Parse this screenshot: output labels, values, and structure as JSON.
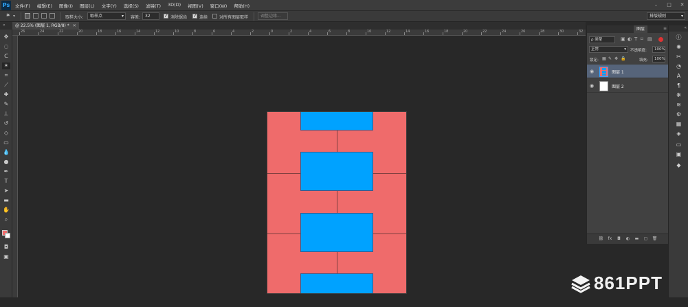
{
  "app": {
    "logo": "Ps",
    "menus": [
      "文件(F)",
      "编辑(E)",
      "图像(I)",
      "图层(L)",
      "文字(Y)",
      "选择(S)",
      "滤镜(T)",
      "3D(D)",
      "视图(V)",
      "窗口(W)",
      "帮助(H)"
    ],
    "window_buttons": [
      "–",
      "□",
      "✕"
    ]
  },
  "options": {
    "sample_size_label": "取样大小:",
    "sample_size_value": "取样点",
    "tolerance_label": "容差:",
    "tolerance_value": "32",
    "antialias_label": "消除锯齿",
    "contiguous_label": "连续",
    "sample_all_label": "对所有图层取样",
    "refine_edge_label": "调整边缘...",
    "workspace_value": "排版规则"
  },
  "document_tab": {
    "label": "@ 22.5% (图层 1, RGB/8) *",
    "close": "✕"
  },
  "ruler": {
    "h_ticks": [
      "26",
      "24",
      "22",
      "20",
      "18",
      "16",
      "14",
      "12",
      "10",
      "8",
      "6",
      "4",
      "2",
      "0",
      "2",
      "4",
      "6",
      "8",
      "10",
      "12",
      "14",
      "16",
      "18",
      "20",
      "22",
      "24",
      "26",
      "28",
      "30",
      "32"
    ]
  },
  "layers_panel": {
    "tab_label": "图层",
    "filter_kind": "ρ 类型",
    "blend_mode": "正常",
    "opacity_label": "不透明度:",
    "opacity_value": "100%",
    "lock_label": "锁定:",
    "fill_label": "填充:",
    "fill_value": "100%",
    "layers": [
      {
        "name": "图层 1",
        "active": true
      },
      {
        "name": "图层 2",
        "active": false
      }
    ],
    "footer_icons": [
      "link-icon",
      "fx-icon",
      "mask-icon",
      "adjustment-icon",
      "folder-icon",
      "new-layer-icon",
      "trash-icon"
    ]
  },
  "watermark": {
    "text": "861PPT"
  },
  "colors": {
    "canvas_pink": "#ef6b6b",
    "canvas_blue": "#00a2ff",
    "foreground": "#ef6b6b",
    "background": "#ffffff"
  }
}
